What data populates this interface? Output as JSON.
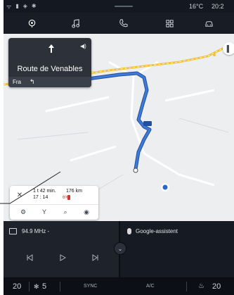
{
  "status_bar": {
    "temperature": "16°C",
    "time": "20:2"
  },
  "nav_tabs": [
    {
      "name": "navigation-icon",
      "active": true
    },
    {
      "name": "music-icon",
      "active": false
    },
    {
      "name": "phone-icon",
      "active": false
    },
    {
      "name": "apps-grid-icon",
      "active": false
    },
    {
      "name": "car-icon",
      "active": false
    }
  ],
  "guidance": {
    "street": "Route de Venables",
    "next_road": "Fra",
    "maneuver_icon": "straight-arrow-icon",
    "next_maneuver_icon": "turn-left-arrow-icon"
  },
  "trip": {
    "duration": "1 t 42 min.",
    "distance": "176 km",
    "eta": "17 : 14",
    "battery": "6%",
    "actions": [
      "settings-icon",
      "route-options-icon",
      "search-icon",
      "pin-icon"
    ]
  },
  "media": {
    "station": "94.9 MHz -",
    "controls": [
      "previous-icon",
      "play-icon",
      "next-icon"
    ]
  },
  "assistant": {
    "label": "Google-assistent"
  },
  "climate": {
    "left_temp": "20",
    "fan_level": "5",
    "sync_label": "SYNC",
    "ac_label": "A/C",
    "right_temp": "20"
  },
  "colors": {
    "route": "#3f7bd6",
    "road_main": "#f2c23a",
    "accent_battery": "#d0342c"
  }
}
